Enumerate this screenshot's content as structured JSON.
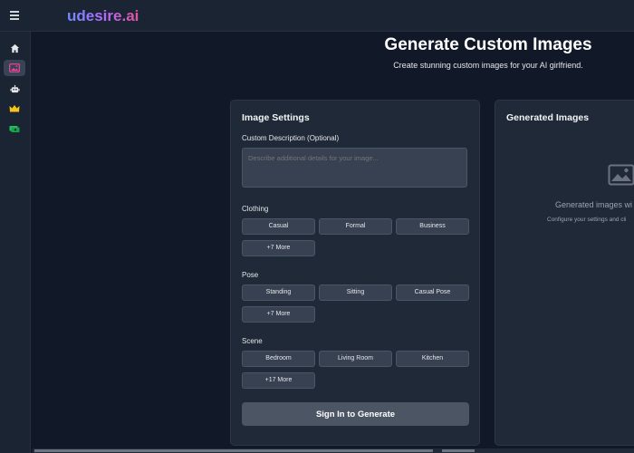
{
  "app": {
    "logo": "udesire.ai"
  },
  "sidebar": {
    "items": [
      {
        "icon": "home-icon"
      },
      {
        "icon": "image-icon",
        "active": true
      },
      {
        "icon": "robot-icon"
      },
      {
        "icon": "crown-icon",
        "color": "#f5c518"
      },
      {
        "icon": "money-icon",
        "color": "#22c55e"
      }
    ]
  },
  "hero": {
    "title": "Generate Custom Images",
    "subtitle": "Create stunning custom images for your AI girlfriend."
  },
  "settings": {
    "title": "Image Settings",
    "description_label": "Custom Description (Optional)",
    "description_placeholder": "Describe additional details for your image...",
    "clothing": {
      "label": "Clothing",
      "options": [
        "Casual",
        "Formal",
        "Business",
        "+7 More"
      ]
    },
    "pose": {
      "label": "Pose",
      "options": [
        "Standing",
        "Sitting",
        "Casual Pose",
        "+7 More"
      ]
    },
    "scene": {
      "label": "Scene",
      "options": [
        "Bedroom",
        "Living Room",
        "Kitchen",
        "+17 More"
      ]
    },
    "cta_label": "Sign In to Generate"
  },
  "generated": {
    "title": "Generated Images",
    "empty_title": "Generated images wi",
    "empty_hint": "Configure your settings and cli"
  },
  "colors": {
    "accent_gradient": [
      "#6d8bff",
      "#b06cff",
      "#e0559a"
    ]
  }
}
